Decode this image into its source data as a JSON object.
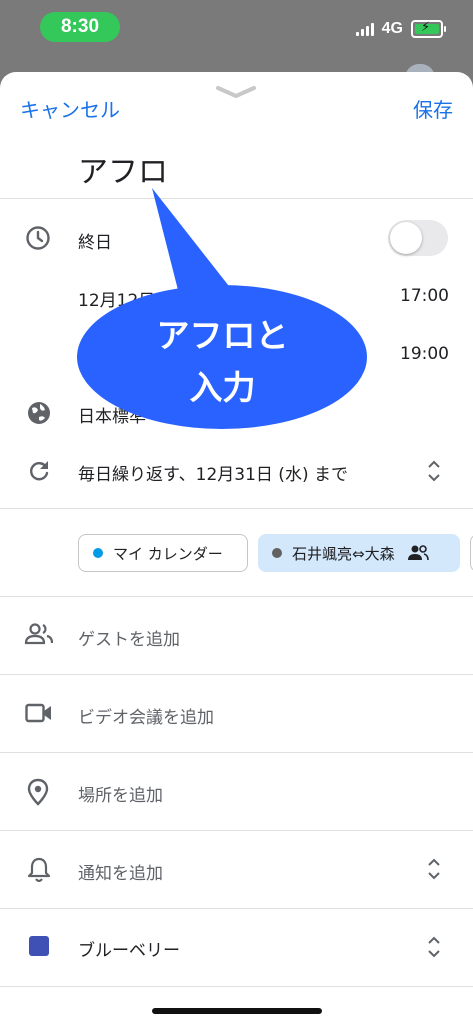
{
  "status": {
    "time": "8:30",
    "network": "4G"
  },
  "header": {
    "cancel_label": "キャンセル",
    "save_label": "保存"
  },
  "event": {
    "title": "アフロ"
  },
  "time_section": {
    "all_day_label": "終日",
    "start_date": "12月12日",
    "start_time": "17:00",
    "end_time": "19:00",
    "timezone": "日本標準",
    "repeat": "毎日繰り返す、12月31日 (水) まで"
  },
  "calendars": [
    {
      "label": "マイ カレンダー",
      "color": "#039be5"
    },
    {
      "label": "石井颯亮⇔大森",
      "color": "#616161"
    }
  ],
  "options": {
    "guests": "ゲストを追加",
    "video": "ビデオ会議を追加",
    "location": "場所を追加",
    "notification": "通知を追加",
    "color_name": "ブルーベリー",
    "color_hex": "#3f51b5"
  },
  "annotation": {
    "line1": "アフロと",
    "line2": "入力",
    "color": "#2962ff"
  }
}
